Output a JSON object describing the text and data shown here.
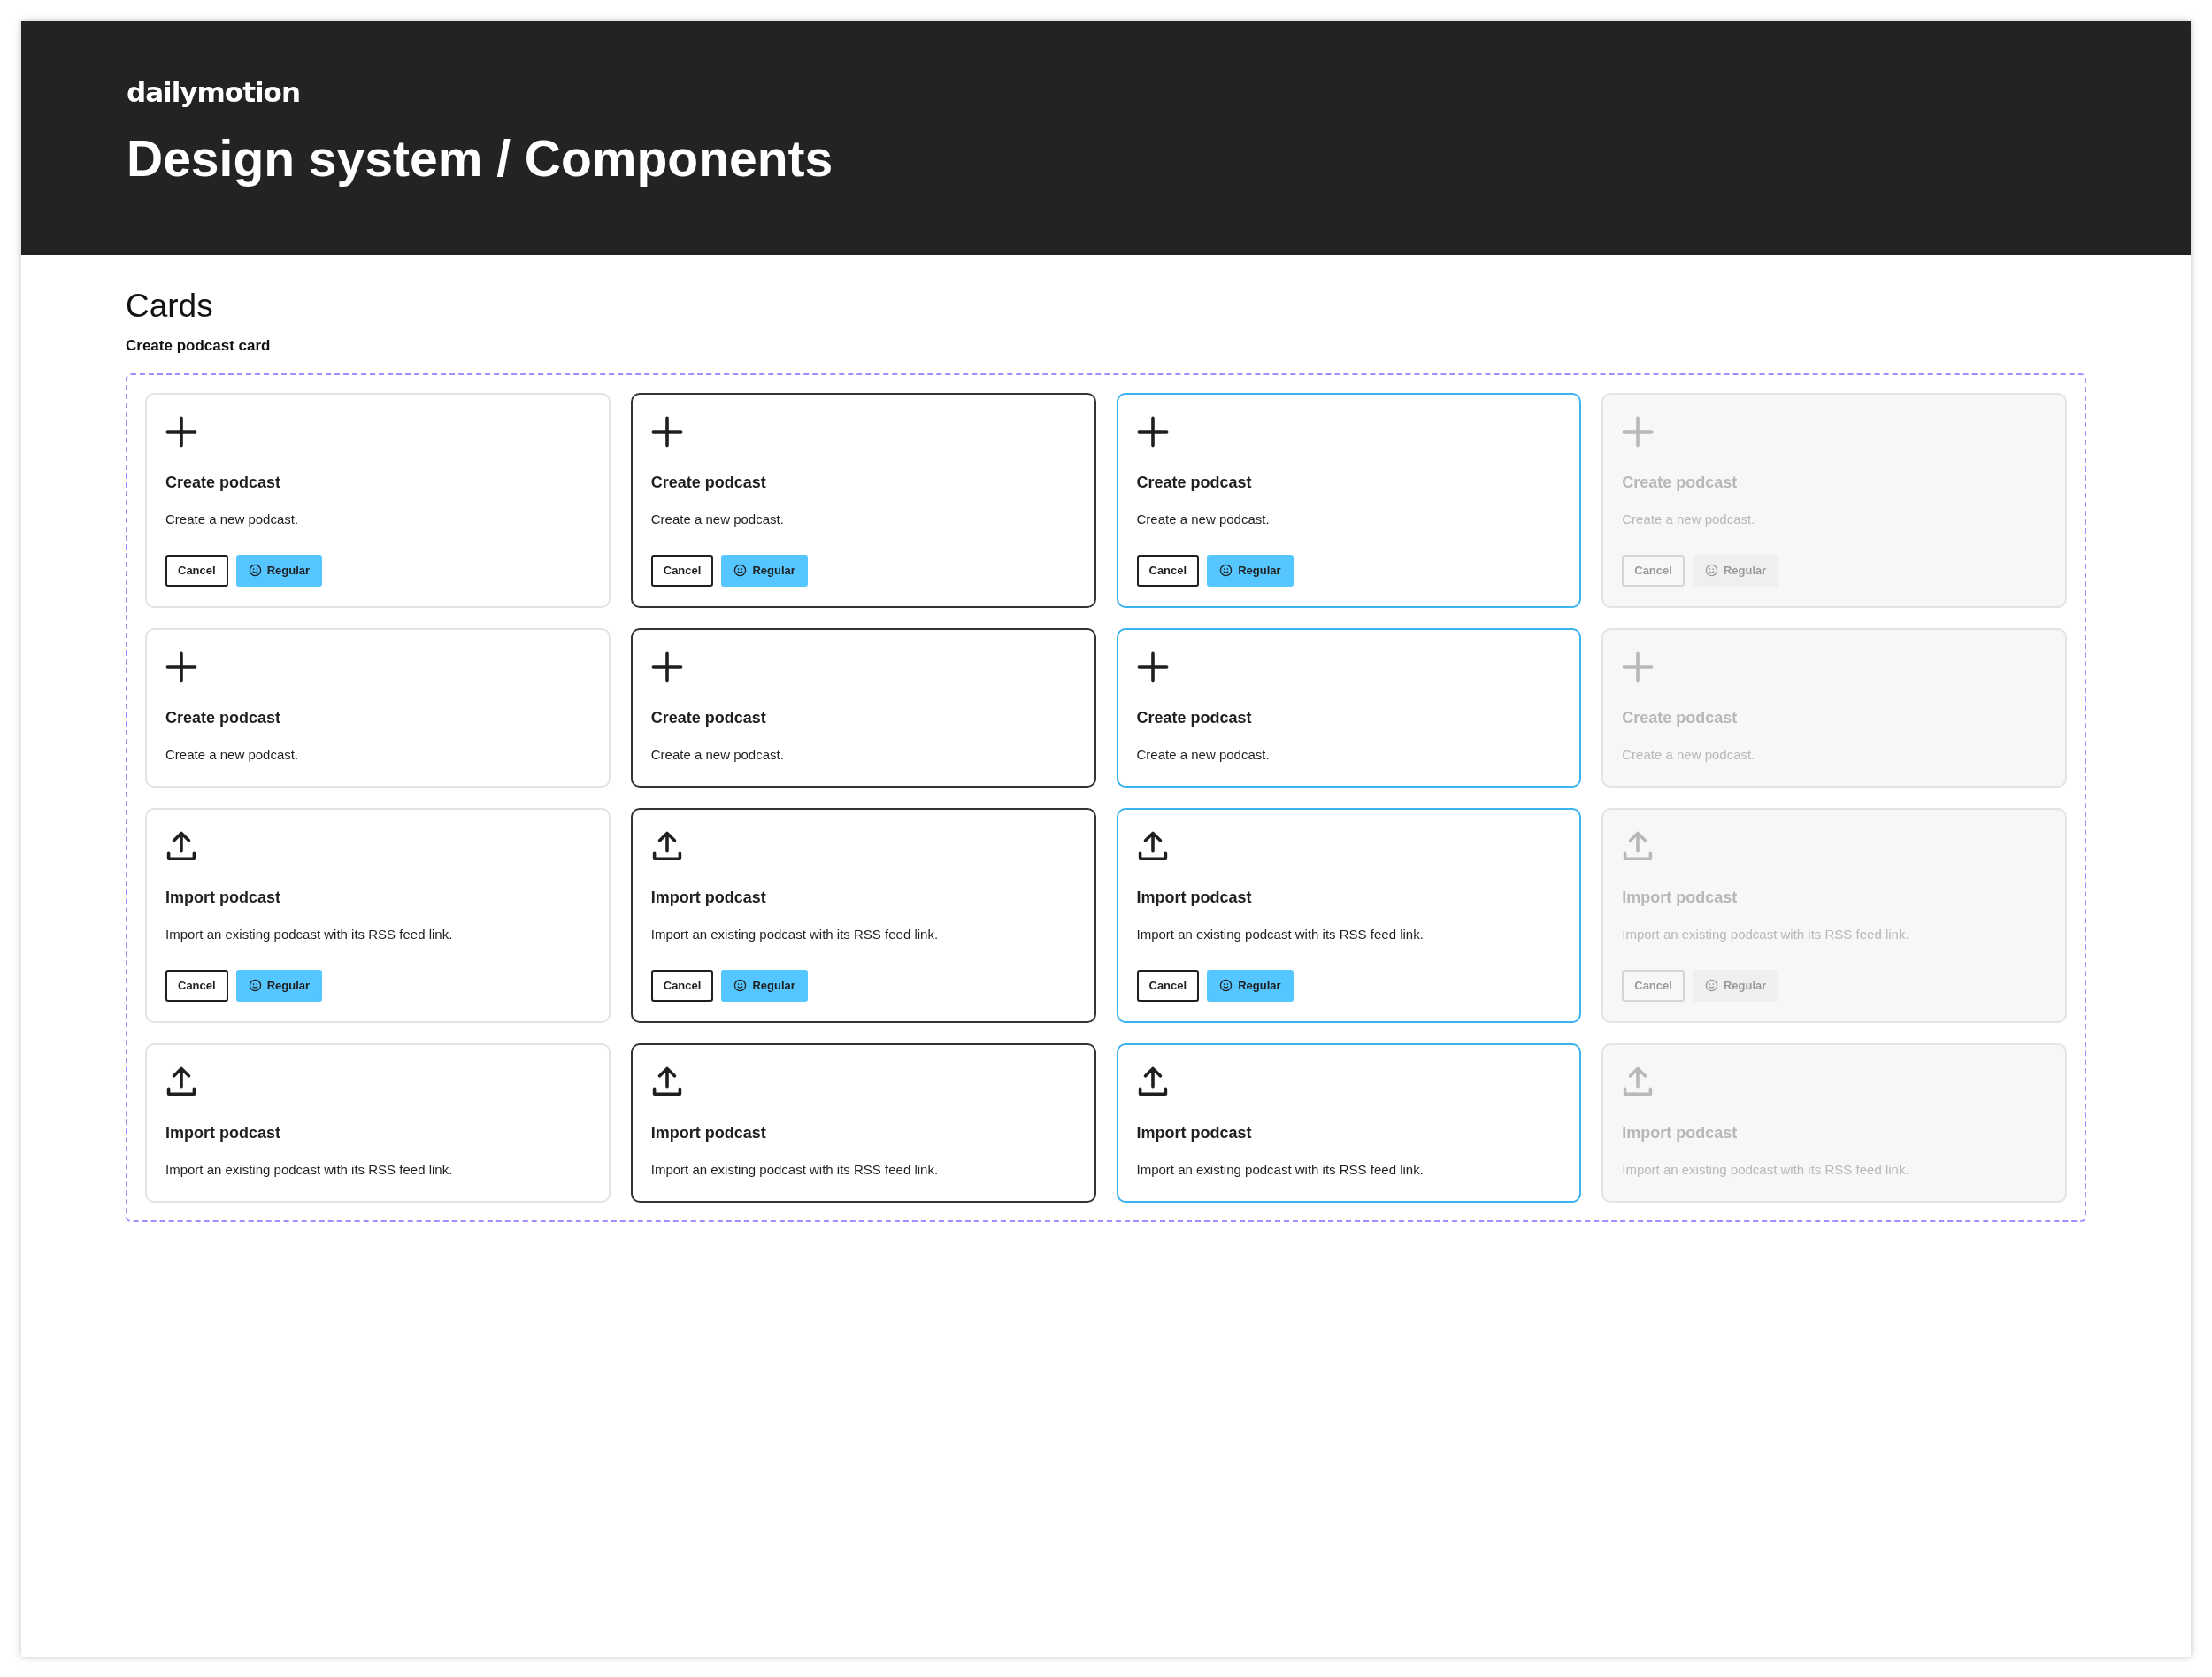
{
  "header": {
    "logo": "dailymotion",
    "title": "Design system / Components"
  },
  "section": {
    "title": "Cards",
    "subtitle": "Create podcast card"
  },
  "cards": [
    {
      "kind": "create",
      "title": "Create podcast",
      "description": "Create a new podcast.",
      "hovered": false,
      "focused": false,
      "disabled": false,
      "buttons": [
        {
          "label": "Cancel",
          "kind": "outline"
        },
        {
          "label": "Regular",
          "kind": "primary"
        }
      ]
    },
    {
      "kind": "create",
      "title": "Create podcast",
      "description": "Create a new podcast.",
      "hovered": true,
      "focused": false,
      "disabled": false,
      "buttons": [
        {
          "label": "Cancel",
          "kind": "outline"
        },
        {
          "label": "Regular",
          "kind": "primary"
        }
      ]
    },
    {
      "kind": "create",
      "title": "Create podcast",
      "description": "Create a new podcast.",
      "hovered": false,
      "focused": true,
      "disabled": false,
      "buttons": [
        {
          "label": "Cancel",
          "kind": "outline"
        },
        {
          "label": "Regular",
          "kind": "primary"
        }
      ]
    },
    {
      "kind": "create",
      "title": "Create podcast",
      "description": "Create a new podcast.",
      "hovered": false,
      "focused": false,
      "disabled": true,
      "buttons": [
        {
          "label": "Cancel",
          "kind": "outline"
        },
        {
          "label": "Regular",
          "kind": "primary"
        }
      ]
    },
    {
      "kind": "create",
      "title": "Create podcast",
      "description": "Create a new podcast.",
      "hovered": false,
      "focused": false,
      "disabled": false
    },
    {
      "kind": "create",
      "title": "Create podcast",
      "description": "Create a new podcast.",
      "hovered": true,
      "focused": false,
      "disabled": false
    },
    {
      "kind": "create",
      "title": "Create podcast",
      "description": "Create a new podcast.",
      "hovered": false,
      "focused": true,
      "disabled": false
    },
    {
      "kind": "create",
      "title": "Create podcast",
      "description": "Create a new podcast.",
      "hovered": false,
      "focused": false,
      "disabled": true
    },
    {
      "kind": "import",
      "title": "Import podcast",
      "description": "Import an existing podcast with its RSS feed link.",
      "hovered": false,
      "focused": false,
      "disabled": false,
      "buttons": [
        {
          "label": "Cancel",
          "kind": "outline"
        },
        {
          "label": "Regular",
          "kind": "primary"
        }
      ]
    },
    {
      "kind": "import",
      "title": "Import podcast",
      "description": "Import an existing podcast with its RSS feed link.",
      "hovered": true,
      "focused": false,
      "disabled": false,
      "buttons": [
        {
          "label": "Cancel",
          "kind": "outline"
        },
        {
          "label": "Regular",
          "kind": "primary"
        }
      ]
    },
    {
      "kind": "import",
      "title": "Import podcast",
      "description": "Import an existing podcast with its RSS feed link.",
      "hovered": false,
      "focused": true,
      "disabled": false,
      "buttons": [
        {
          "label": "Cancel",
          "kind": "outline"
        },
        {
          "label": "Regular",
          "kind": "primary"
        }
      ]
    },
    {
      "kind": "import",
      "title": "Import podcast",
      "description": "Import an existing podcast with its RSS feed link.",
      "hovered": false,
      "focused": false,
      "disabled": true,
      "buttons": [
        {
          "label": "Cancel",
          "kind": "outline"
        },
        {
          "label": "Regular",
          "kind": "primary"
        }
      ]
    },
    {
      "kind": "import",
      "title": "Import podcast",
      "description": "Import an existing podcast with its RSS feed link.",
      "hovered": false,
      "focused": false,
      "disabled": false
    },
    {
      "kind": "import",
      "title": "Import podcast",
      "description": "Import an existing podcast with its RSS feed link.",
      "hovered": true,
      "focused": false,
      "disabled": false
    },
    {
      "kind": "import",
      "title": "Import podcast",
      "description": "Import an existing podcast with its RSS feed link.",
      "hovered": false,
      "focused": true,
      "disabled": false
    },
    {
      "kind": "import",
      "title": "Import podcast",
      "description": "Import an existing podcast with its RSS feed link.",
      "hovered": false,
      "focused": false,
      "disabled": true
    }
  ]
}
